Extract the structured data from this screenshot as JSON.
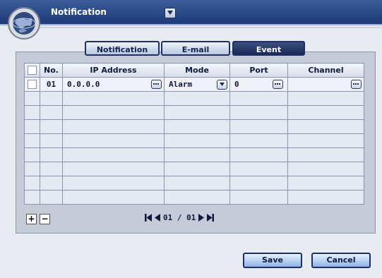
{
  "window": {
    "title": "Notification"
  },
  "tabs": [
    {
      "label": "Notification",
      "active": false
    },
    {
      "label": "E-mail",
      "active": false
    },
    {
      "label": "Event",
      "active": true
    }
  ],
  "table": {
    "headers": {
      "no": "No.",
      "ip": "IP Address",
      "mode": "Mode",
      "port": "Port",
      "channel": "Channel"
    },
    "rows": [
      {
        "no": "01",
        "ip": "0.0.0.0",
        "mode": "Alarm",
        "port": "0",
        "channel": ""
      }
    ],
    "empty_rows": 8
  },
  "pager": {
    "text": "01 / 01"
  },
  "buttons": {
    "add": "+",
    "remove": "−",
    "save": "Save",
    "cancel": "Cancel"
  },
  "colors": {
    "accent": "#1d2f66",
    "titlebar": "#2a4a8a",
    "panel": "#c5ccd8"
  },
  "icons": {
    "logo": "globe-logo-icon",
    "title_dropdown": "chevron-down-icon",
    "more": "ellipsis-icon",
    "first": "first-page-icon",
    "prev": "previous-page-icon",
    "next": "next-page-icon",
    "last": "last-page-icon"
  }
}
